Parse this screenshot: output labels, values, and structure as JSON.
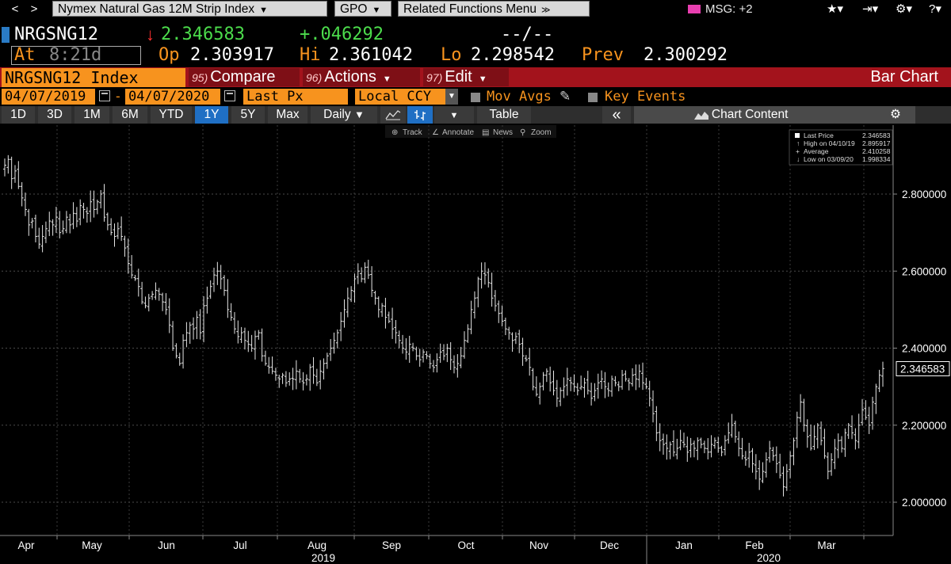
{
  "menubar": {
    "back_icon": "chevron-left-icon",
    "forward_icon": "chevron-right-icon",
    "security_menu": "Nymex Natural Gas 12M Strip Index",
    "function_menu": "GPO",
    "related_menu": "Related Functions Menu",
    "msg_label": "MSG: +2",
    "star_icon": "★▾",
    "export_icon": "⇥▾",
    "gear_icon": "⚙▾",
    "help_icon": "?▾"
  },
  "ticker": {
    "symbol": "NRGSNG12",
    "direction_arrow": "↓",
    "last": "2.346583",
    "change": "+.046292",
    "bid_ask": "--/--",
    "time_label": "At",
    "time_value": "8:21d",
    "open_label": "Op",
    "open": "2.303917",
    "high_label": "Hi",
    "high": "2.361042",
    "low_label": "Lo",
    "low": "2.298542",
    "prev_label": "Prev",
    "prev": "2.300292",
    "colors": {
      "up": "#4cdc4c",
      "down": "#ff3030",
      "label": "#f7931e",
      "accent": "#a3131c"
    }
  },
  "functionbar": {
    "security": "NRGSNG12 Index",
    "compare_num": "95)",
    "compare": "Compare",
    "actions_num": "96)",
    "actions": "Actions",
    "edit_num": "97)",
    "edit": "Edit",
    "chart_type": "Bar Chart"
  },
  "settings": {
    "start_date": "04/07/2019",
    "separator": "-",
    "end_date": "04/07/2020",
    "field": "Last Px",
    "currency": "Local CCY",
    "mov_avgs": "Mov Avgs",
    "key_events": "Key Events"
  },
  "toolbar": {
    "ranges": [
      "1D",
      "3D",
      "1M",
      "6M",
      "YTD",
      "1Y",
      "5Y",
      "Max"
    ],
    "active_range": "1Y",
    "frequency": "Daily",
    "table": "Table",
    "collapse": "«",
    "chart_content": "Chart Content",
    "chart_content_icon": "mountain-chart-icon",
    "settings_icon": "gear-icon"
  },
  "chart_menu": {
    "track": "Track",
    "annotate": "Annotate",
    "news": "News",
    "zoom": "Zoom"
  },
  "chart_data": {
    "type": "ohlc-bar",
    "title": "",
    "xlabel": "",
    "ylabel": "",
    "ylim": [
      1.97,
      2.98
    ],
    "yticks": [
      "2.000000",
      "2.200000",
      "2.400000",
      "2.600000",
      "2.800000"
    ],
    "ytick_values": [
      2.0,
      2.2,
      2.4,
      2.6,
      2.8
    ],
    "xticks": [
      "Apr",
      "May",
      "Jun",
      "Jul",
      "Aug",
      "Sep",
      "Oct",
      "Nov",
      "Dec",
      "Jan",
      "Feb",
      "Mar"
    ],
    "year_labels": [
      "2019",
      "2020"
    ],
    "last_price_label": "2.346583",
    "last_price_value": 2.346583,
    "bar_color": "#e6e6e6",
    "grid": true,
    "legend_position": "top-right",
    "legend": [
      {
        "label": "Last Price",
        "value": "2.346583"
      },
      {
        "label": "High on 04/10/19",
        "value": "2.895917"
      },
      {
        "label": "Average",
        "value": "2.410258"
      },
      {
        "label": "Low on 03/09/20",
        "value": "1.998334"
      }
    ],
    "closes": [
      2.875,
      2.89,
      2.84,
      2.86,
      2.82,
      2.79,
      2.76,
      2.72,
      2.73,
      2.69,
      2.67,
      2.69,
      2.71,
      2.73,
      2.72,
      2.74,
      2.7,
      2.71,
      2.74,
      2.72,
      2.75,
      2.73,
      2.77,
      2.76,
      2.75,
      2.78,
      2.76,
      2.78,
      2.8,
      2.74,
      2.72,
      2.7,
      2.69,
      2.71,
      2.69,
      2.66,
      2.62,
      2.59,
      2.58,
      2.56,
      2.52,
      2.51,
      2.53,
      2.54,
      2.55,
      2.54,
      2.52,
      2.5,
      2.46,
      2.4,
      2.38,
      2.36,
      2.42,
      2.44,
      2.46,
      2.45,
      2.48,
      2.44,
      2.51,
      2.53,
      2.56,
      2.59,
      2.6,
      2.58,
      2.55,
      2.5,
      2.48,
      2.45,
      2.43,
      2.44,
      2.42,
      2.41,
      2.4,
      2.43,
      2.44,
      2.38,
      2.36,
      2.35,
      2.34,
      2.33,
      2.32,
      2.33,
      2.31,
      2.32,
      2.32,
      2.34,
      2.32,
      2.31,
      2.32,
      2.35,
      2.33,
      2.31,
      2.34,
      2.36,
      2.38,
      2.4,
      2.42,
      2.44,
      2.47,
      2.5,
      2.53,
      2.55,
      2.58,
      2.6,
      2.58,
      2.61,
      2.59,
      2.55,
      2.53,
      2.5,
      2.51,
      2.48,
      2.47,
      2.45,
      2.44,
      2.42,
      2.4,
      2.39,
      2.41,
      2.4,
      2.38,
      2.37,
      2.39,
      2.38,
      2.36,
      2.35,
      2.37,
      2.39,
      2.38,
      2.4,
      2.37,
      2.35,
      2.36,
      2.38,
      2.42,
      2.45,
      2.5,
      2.53,
      2.58,
      2.6,
      2.59,
      2.57,
      2.53,
      2.51,
      2.49,
      2.47,
      2.45,
      2.44,
      2.42,
      2.43,
      2.41,
      2.38,
      2.37,
      2.35,
      2.3,
      2.28,
      2.3,
      2.33,
      2.34,
      2.31,
      2.29,
      2.27,
      2.29,
      2.3,
      2.32,
      2.31,
      2.3,
      2.29,
      2.3,
      2.31,
      2.29,
      2.27,
      2.29,
      2.31,
      2.32,
      2.3,
      2.29,
      2.32,
      2.31,
      2.3,
      2.33,
      2.32,
      2.31,
      2.33,
      2.32,
      2.34,
      2.31,
      2.3,
      2.27,
      2.23,
      2.18,
      2.16,
      2.15,
      2.14,
      2.15,
      2.13,
      2.14,
      2.16,
      2.15,
      2.13,
      2.15,
      2.14,
      2.16,
      2.15,
      2.14,
      2.13,
      2.15,
      2.16,
      2.14,
      2.13,
      2.16,
      2.18,
      2.2,
      2.17,
      2.14,
      2.12,
      2.11,
      2.13,
      2.1,
      2.08,
      2.06,
      2.08,
      2.11,
      2.14,
      2.12,
      2.1,
      2.07,
      2.04,
      2.08,
      2.12,
      2.16,
      2.22,
      2.26,
      2.2,
      2.17,
      2.14,
      2.17,
      2.2,
      2.16,
      2.12,
      2.08,
      2.11,
      2.14,
      2.16,
      2.14,
      2.18,
      2.2,
      2.18,
      2.16,
      2.2,
      2.24,
      2.22,
      2.2,
      2.26,
      2.3,
      2.33,
      2.347
    ]
  }
}
